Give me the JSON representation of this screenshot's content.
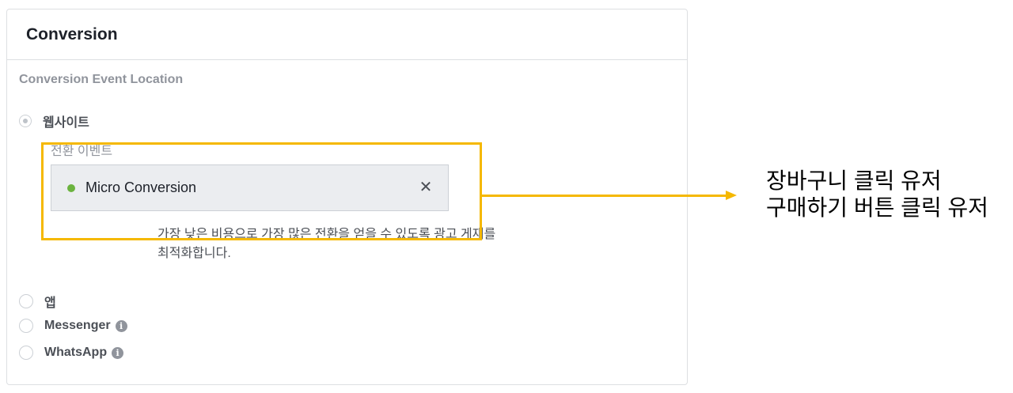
{
  "card": {
    "title": "Conversion",
    "section_label": "Conversion Event Location"
  },
  "options": {
    "website": "웹사이트",
    "app": "앱",
    "messenger": "Messenger",
    "whatsapp": "WhatsApp"
  },
  "event": {
    "sub_label": "전환 이벤트",
    "name": "Micro Conversion",
    "close_glyph": "✕",
    "status_color": "#6bb33f",
    "help_line1": "가장 낮은 비용으로 가장 많은 전환을 얻을 수 있도록 광고 게재를",
    "help_line2": "최적화합니다."
  },
  "info_glyph": "i",
  "annotation": {
    "line1": "장바구니 클릭 유저",
    "line2": "구매하기 버튼 클릭 유저",
    "highlight_color": "#f5b800"
  }
}
